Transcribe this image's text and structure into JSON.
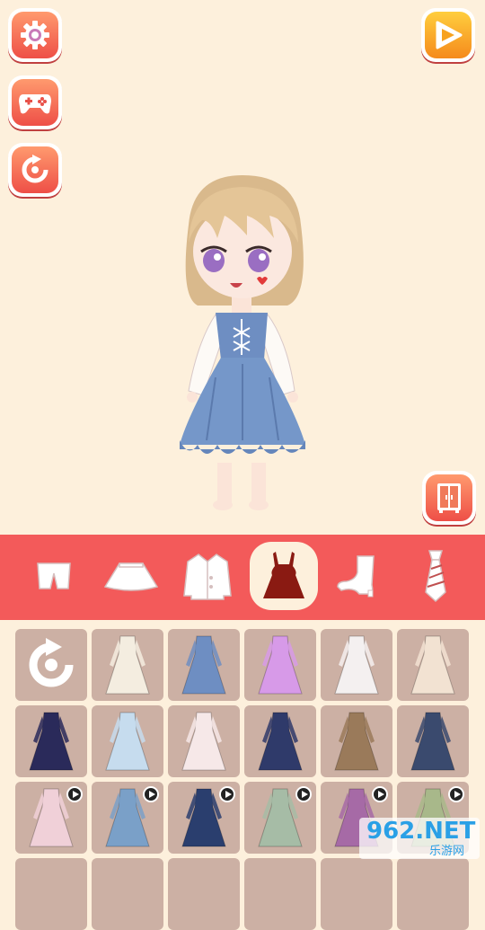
{
  "buttons": {
    "settings": "gear-icon",
    "games": "gamepad-icon",
    "reset": "reset-icon",
    "play": "play-icon",
    "wardrobe": "wardrobe-icon"
  },
  "categories": [
    "pants",
    "skirt",
    "jacket",
    "dress",
    "boots",
    "tie"
  ],
  "active_category": "dress",
  "watermark": {
    "number": "962.NET",
    "site": "乐游网"
  },
  "colors": {
    "accent": "#f35a5a",
    "bg": "#fdf0dc",
    "tile": "#ccb0a4"
  }
}
